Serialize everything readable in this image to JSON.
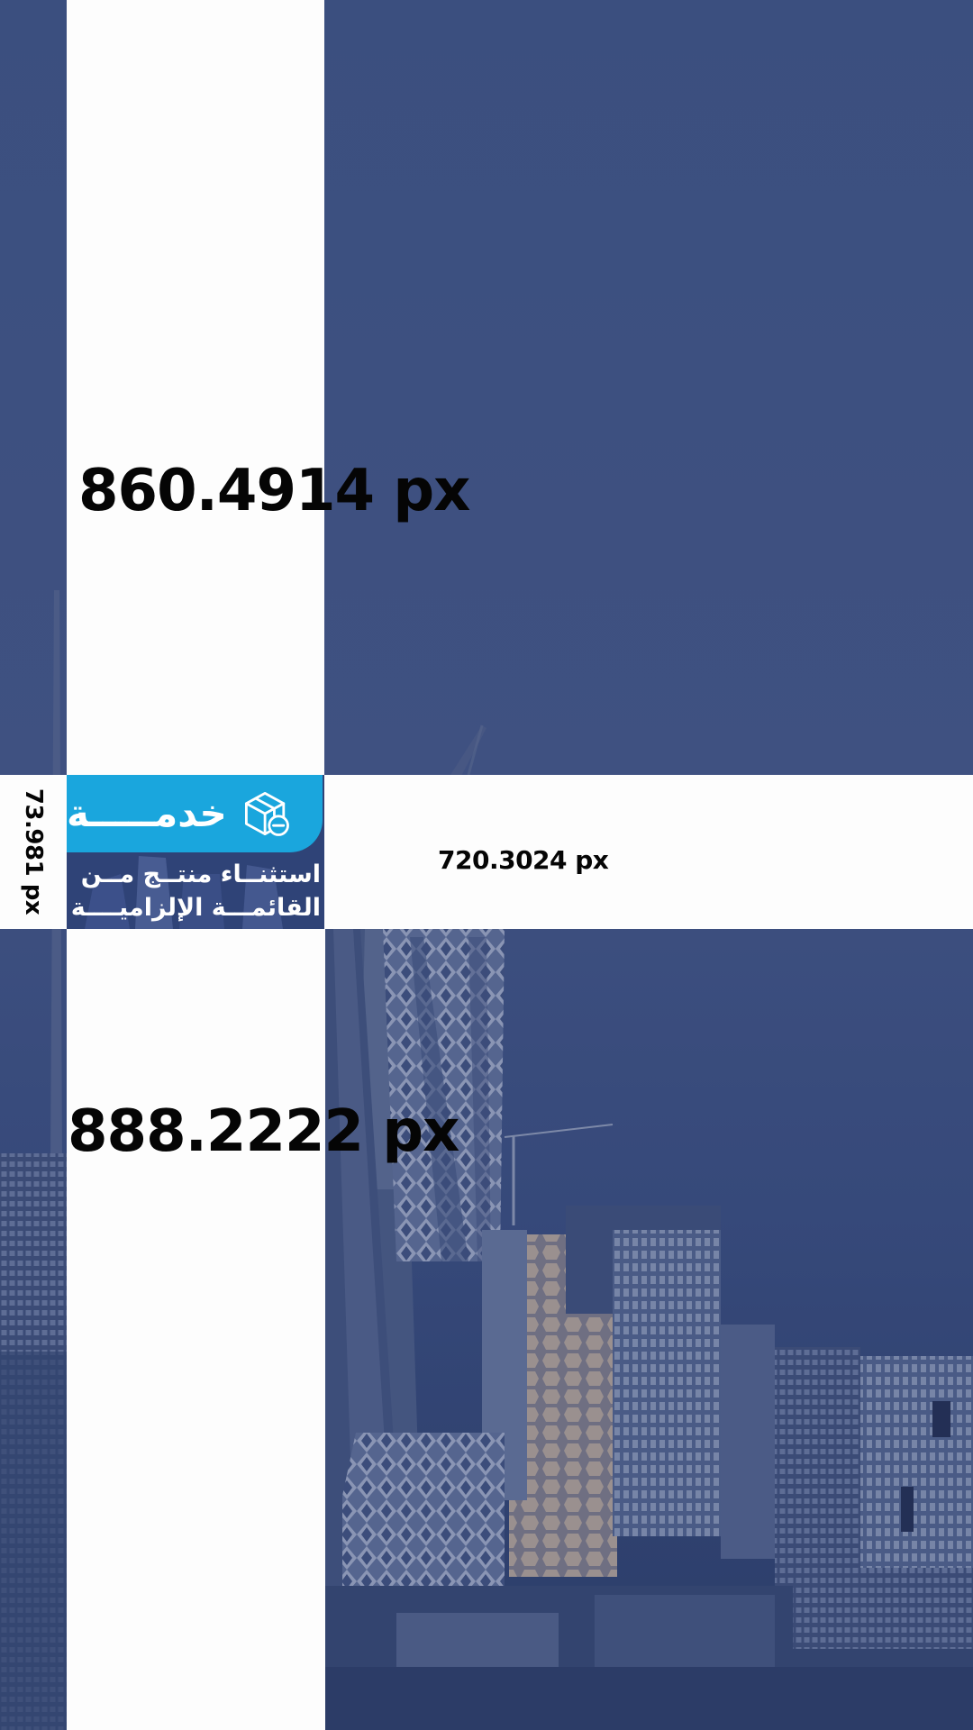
{
  "measurements": {
    "top": "860.4914 px",
    "bottom": "888.2222 px",
    "middle": "720.3024 px",
    "left": "73.981 px"
  },
  "service_card": {
    "title": "خدمـــــة",
    "icon": "box-minus-icon",
    "line_1": "استثنــاء منتــج مــن",
    "line_2": "القائمـــة الإلزاميــــة"
  },
  "colors": {
    "background": "#3a4d7c",
    "card_header": "#1aa6dd",
    "card_body": "#2f4377",
    "band": "#fdfdfd"
  }
}
